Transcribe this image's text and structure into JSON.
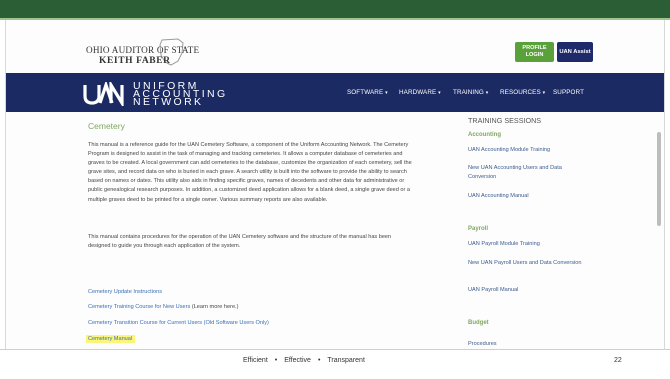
{
  "header": {
    "logo_line1": "OHIO AUDITOR OF STATE",
    "logo_line2": "KEITH FABER",
    "profile_login_line1": "PROFILE",
    "profile_login_line2": "LOGIN",
    "uan_assist": "UAN Assist"
  },
  "brand": {
    "word1": "UNIFORM",
    "word2": "ACCOUNTING",
    "word3": "NETWORK",
    "nav_color": "#1b2a63",
    "accent_green": "#7fa85f"
  },
  "nav": {
    "software": "SOFTWARE",
    "hardware": "HARDWARE",
    "training": "TRAINING",
    "resources": "RESOURCES",
    "support": "SUPPORT"
  },
  "main": {
    "title": "Cemetery",
    "paragraph1": "This manual is a reference guide for the UAN Cemetery Software, a component of the Uniform Accounting Network. The Cemetery Program is designed to assist in the task of managing and tracking cemeteries. It allows a computer database of cemeteries and graves to be created. A local government can add cemeteries to the database, customize the organization of each cemetery, sell the grave sites, and record data on who is buried in each grave. A search utility is built into the software to provide the ability to search based on names or dates. This utility also aids in finding specific graves, names of decedents and other data for administrative or public genealogical research purposes. In addition, a customized deed application allows for a blank deed, a single grave deed or a multiple graves deed to be printed for a single owner. Various summary reports are also available.",
    "paragraph2": "This manual contains procedures for the operation of the UAN Cemetery software and the structure of the manual has been designed to guide you through each application of the system.",
    "link_update": "Cemetery Update Instructions",
    "link_training": "Cemetery Training Course for New Users",
    "link_training_extra": " (Learn more here.)",
    "link_transition": "Cemetery Transition Course for Current Users (Old Software Users Only)",
    "link_manual": "Cemetery Manual"
  },
  "sidebar": {
    "title": "TRAINING SESSIONS",
    "accounting_heading": "Accounting",
    "accounting_items": [
      "UAN Accounting Module Training",
      "New UAN Accounting Users and Data Conversion",
      "UAN Accounting Manual"
    ],
    "payroll_heading": "Payroll",
    "payroll_items": [
      "UAN Payroll Module Training",
      "New UAN Payroll Users and Data Conversion",
      "UAN Payroll Manual"
    ],
    "budget_heading": "Budget",
    "budget_item_partial": "Procedures"
  },
  "footer": {
    "word1": "Efficient",
    "word2": "Effective",
    "word3": "Transparent",
    "separator": "•",
    "page_number": "22"
  }
}
